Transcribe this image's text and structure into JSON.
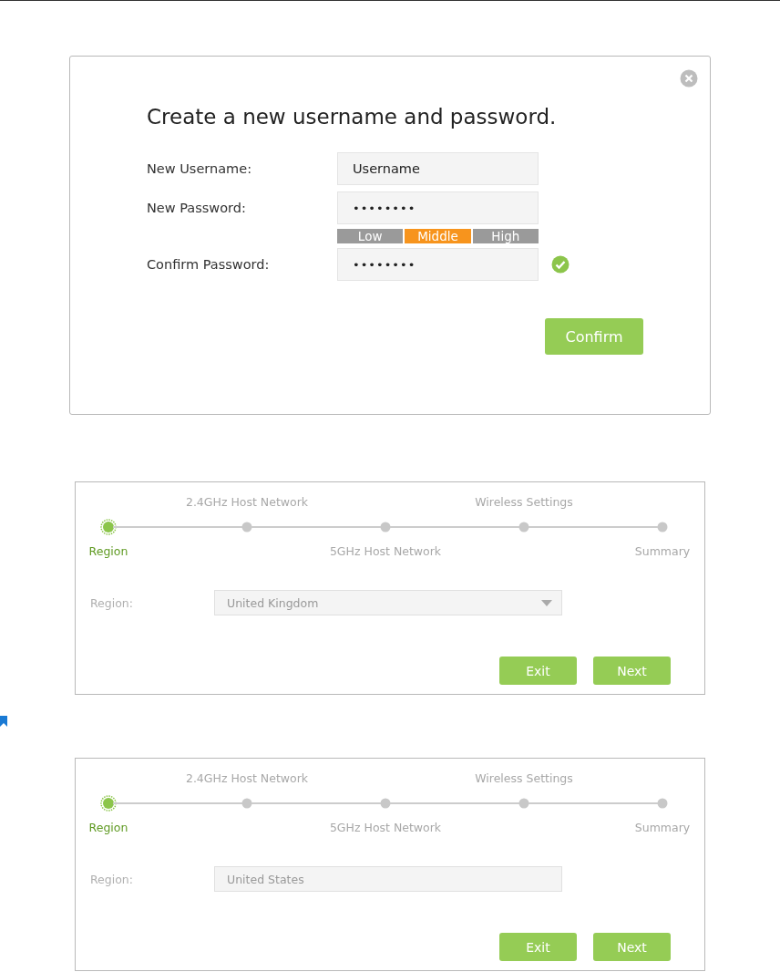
{
  "dialog": {
    "title": "Create a new username and password.",
    "fields": [
      {
        "kind": "text",
        "label": "New Username:",
        "value": "Username"
      },
      {
        "kind": "password",
        "label": "New Password:",
        "value": "••••••••",
        "strength": [
          {
            "label": "Low",
            "selected": false
          },
          {
            "label": "Middle",
            "selected": true
          },
          {
            "label": "High",
            "selected": false
          }
        ]
      },
      {
        "kind": "password",
        "label": "Confirm Password:",
        "value": "••••••••",
        "valid": true
      }
    ],
    "confirm_button": "Confirm"
  },
  "wizards": [
    {
      "steps": [
        {
          "label": "Region",
          "selected": true
        },
        {
          "label": "2.4GHz Host Network",
          "selected": false
        },
        {
          "label": "5GHz Host Network",
          "selected": false
        },
        {
          "label": "Wireless Settings",
          "selected": false
        },
        {
          "label": "Summary",
          "selected": false
        }
      ],
      "region_label": "Region:",
      "region_value": "United Kingdom",
      "dropdown": true,
      "buttons": [
        "Exit",
        "Next"
      ]
    },
    {
      "steps": [
        {
          "label": "Region",
          "selected": true
        },
        {
          "label": "2.4GHz Host Network",
          "selected": false
        },
        {
          "label": "5GHz Host Network",
          "selected": false
        },
        {
          "label": "Wireless Settings",
          "selected": false
        },
        {
          "label": "Summary",
          "selected": false
        }
      ],
      "region_label": "Region:",
      "region_value": "United States",
      "dropdown": false,
      "buttons": [
        "Exit",
        "Next"
      ]
    }
  ]
}
